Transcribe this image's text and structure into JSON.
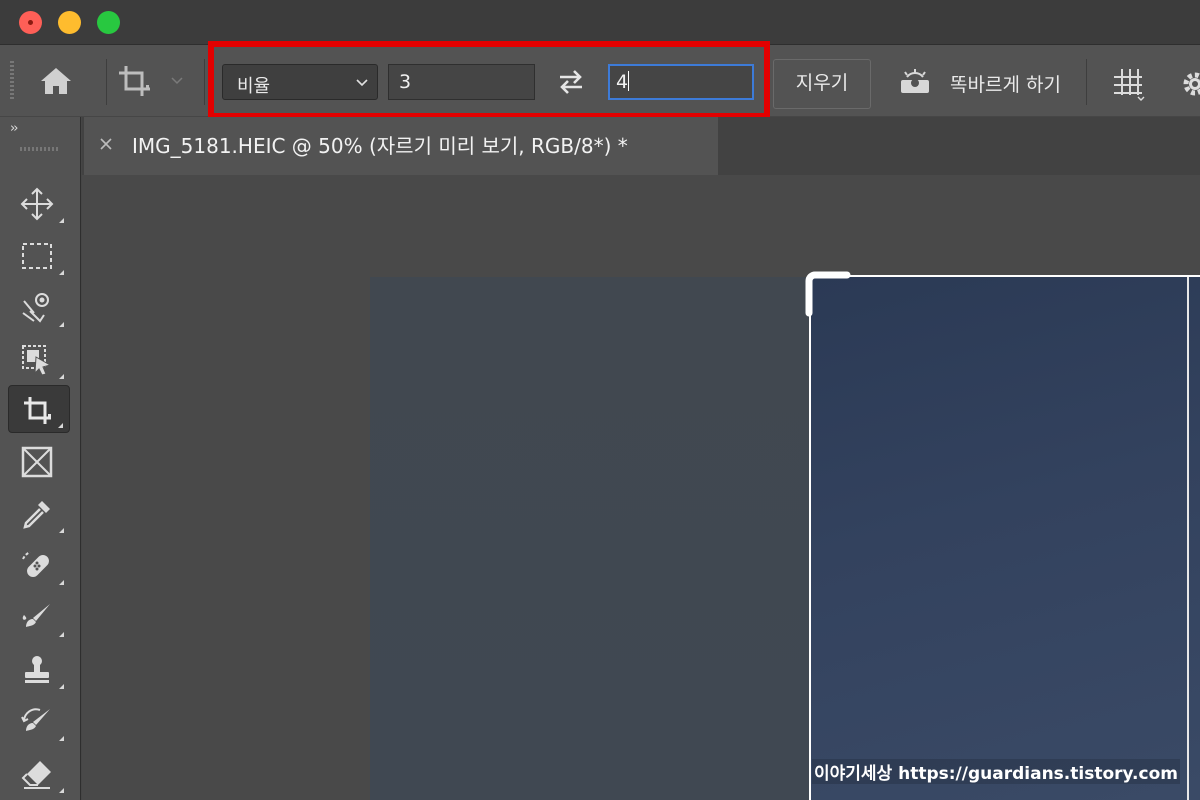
{
  "window": {
    "controls": [
      "close",
      "minimize",
      "maximize"
    ]
  },
  "options_bar": {
    "home_icon": "home-icon",
    "tool_preset_icon": "crop-icon",
    "ratio_select": {
      "selected": "비율"
    },
    "width_value": "3",
    "height_value": "4",
    "swap_icon": "swap-arrows-icon",
    "clear_label": "지우기",
    "straighten_label": "똑바르게 하기",
    "overlay_icon": "grid-overlay-icon",
    "settings_icon": "gear-icon",
    "highlight_color": "#e30000"
  },
  "toolbar": {
    "collapse_label": "››",
    "tools": [
      {
        "name": "move-tool",
        "icon": "move-icon"
      },
      {
        "name": "marquee-tool",
        "icon": "marquee-icon"
      },
      {
        "name": "object-selection-tool",
        "icon": "lasso-icon"
      },
      {
        "name": "object-select-tool",
        "icon": "object-select-icon"
      },
      {
        "name": "crop-tool",
        "icon": "crop-icon",
        "active": true
      },
      {
        "name": "frame-tool",
        "icon": "frame-icon"
      },
      {
        "name": "eyedropper-tool",
        "icon": "eyedropper-icon"
      },
      {
        "name": "healing-brush-tool",
        "icon": "bandage-icon"
      },
      {
        "name": "brush-tool",
        "icon": "brush-icon"
      },
      {
        "name": "clone-stamp-tool",
        "icon": "stamp-icon"
      },
      {
        "name": "history-brush-tool",
        "icon": "history-brush-icon"
      },
      {
        "name": "eraser-tool",
        "icon": "eraser-icon"
      }
    ]
  },
  "document": {
    "tab_title": "IMG_5181.HEIC @ 50% (자르기 미리 보기, RGB/8*) *",
    "watermark": "이야기세상 https://guardians.tistory.com"
  }
}
